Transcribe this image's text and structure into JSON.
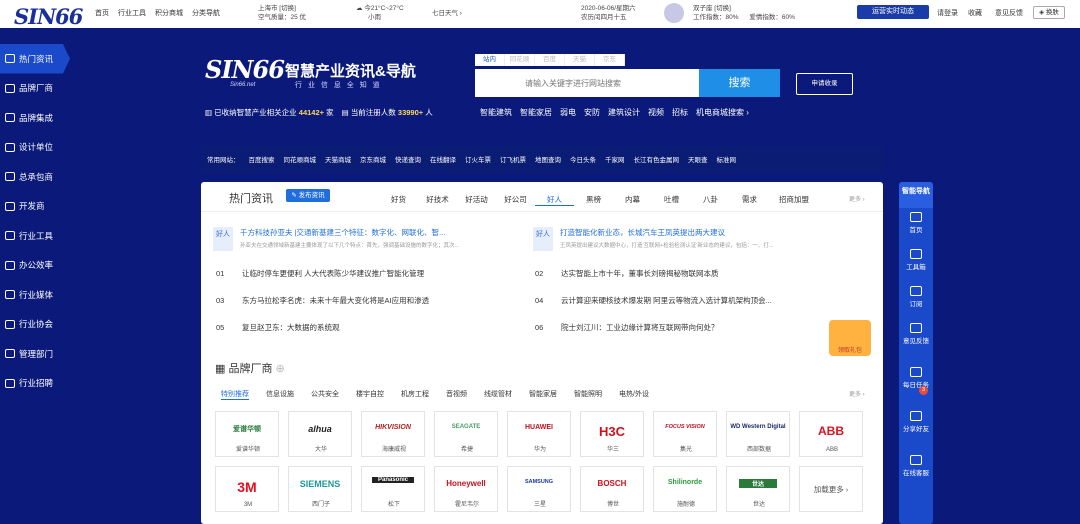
{
  "top": {
    "logo": "SIN66",
    "nav": [
      "首页",
      "行业工具",
      "积分商城",
      "分类导航"
    ],
    "city": "上海市 [切换]",
    "air": "空气质量：25 优",
    "temp": "今21°C~27°C",
    "weather": "小雨",
    "seven": "七日天气 ›",
    "date": "2020-06-06/星期六",
    "lunar": "农历闰四月十五",
    "user": "双子座 [切换]",
    "work": "工作指数：80%",
    "love": "爱情指数：60%",
    "game_btn": "运营实时动态",
    "login": "请登录",
    "fav": "收藏",
    "feedback": "意见反馈",
    "switch": "换肤"
  },
  "sidebar": [
    "热门资讯",
    "品牌厂商",
    "品牌集成",
    "设计单位",
    "总承包商",
    "开发商",
    "行业工具",
    "办公效率",
    "行业媒体",
    "行业协会",
    "管理部门",
    "行业招聘"
  ],
  "hero": {
    "brand": "SIN66",
    "brand_sub": "智慧产业资讯&导航",
    "brand_tag": "行 业 信 息 全 知 道",
    "brand_url": "Sin66.net",
    "search_tabs": [
      "站内",
      "同花顺",
      "百度",
      "天猫",
      "京东"
    ],
    "search_placeholder": "请输入关键字进行网站搜索",
    "search_btn": "搜索",
    "apply": "申请收录",
    "stat1_pre": "已收纳智慧产业相关企业",
    "stat1_num": "44142+",
    "stat1_unit": "家",
    "stat2_pre": "当前注册人数",
    "stat2_num": "33990+",
    "stat2_unit": "人",
    "hotlinks": [
      "智能建筑",
      "智能家居",
      "弱电",
      "安防",
      "建筑设计",
      "视频",
      "招标",
      "机电商城搜索 ›"
    ],
    "common": [
      "常用网站：",
      "百度搜索",
      "同花顺商城",
      "天猫商城",
      "京东商城",
      "快递查询",
      "在线翻译",
      "订火车票",
      "订飞机票",
      "地图查询",
      "今日头条",
      "千家网",
      "长江有色金属网",
      "天眼查",
      "标准网"
    ]
  },
  "news": {
    "title": "热门资讯",
    "pub": "发布资讯",
    "tabs": [
      "好货",
      "好技术",
      "好活动",
      "好公司",
      "好人",
      "黑榜",
      "内幕",
      "吐槽",
      "八卦",
      "需求",
      "招商加盟"
    ],
    "more": "更多 ›",
    "feat": [
      {
        "badge": "好人",
        "title": "千方科技孙亚夫 |交通新基建三个特征：数字化、网联化、智...",
        "desc": "孙亚夫在交通领域新基建主要体现了以下几个特点：首先，强调基础设施的数字化；其次..."
      },
      {
        "badge": "好人",
        "title": "打造智能化新业态，长城汽车王凤英提出两大建议",
        "desc": "王凤英提出建议大数据中心，打造'互联网+检验检测认证'新业态的建议，包括：一、打..."
      }
    ],
    "left": [
      {
        "no": "01",
        "t": "让临时停车更便利 人大代表陈少华建议推广智能化管理"
      },
      {
        "no": "03",
        "t": "东方马拉松李名虎：未来十年最大变化将是AI应用和渗透"
      },
      {
        "no": "05",
        "t": "复旦赵卫东：大数据的系统观"
      }
    ],
    "right": [
      {
        "no": "02",
        "t": "达实智能上市十年，董事长刘磅揭秘物联网本质"
      },
      {
        "no": "04",
        "t": "云计算迎来硬核技术爆发期 阿里云等物流入选计算机架构顶会..."
      },
      {
        "no": "06",
        "t": "院士刘江川：工业边缘计算将互联网带向何处？"
      }
    ]
  },
  "brands": {
    "title": "品牌厂商",
    "tabs": [
      "特别推荐",
      "信息设施",
      "公共安全",
      "楼宇自控",
      "机房工程",
      "音视频",
      "线缆管材",
      "智能家居",
      "智能照明",
      "电热/外设"
    ],
    "row1": [
      {
        "logo": "爱谱华顿",
        "name": "爱谱华顿"
      },
      {
        "logo": "alhua",
        "name": "大华"
      },
      {
        "logo": "HIKVISION",
        "name": "海康威视"
      },
      {
        "logo": "SEAGATE",
        "name": "希捷"
      },
      {
        "logo": "HUAWEI",
        "name": "华为"
      },
      {
        "logo": "H3C",
        "name": "华三"
      },
      {
        "logo": "FOCUS VISION",
        "name": "集光"
      },
      {
        "logo": "WD Western Digital",
        "name": "西部数据"
      },
      {
        "logo": "ABB",
        "name": "ABB"
      }
    ],
    "row2": [
      {
        "logo": "3M",
        "name": "3M"
      },
      {
        "logo": "SIEMENS",
        "name": "西门子"
      },
      {
        "logo": "Panasonic",
        "name": "松下"
      },
      {
        "logo": "Honeywell",
        "name": "霍尼韦尔"
      },
      {
        "logo": "SAMSUNG",
        "name": "三星"
      },
      {
        "logo": "BOSCH",
        "name": "博世"
      },
      {
        "logo": "Shilinorde",
        "name": "施耐德"
      },
      {
        "logo": "世达",
        "name": "世达"
      },
      {
        "logo": "加载更多 ›",
        "name": ""
      }
    ],
    "more": "更多 ›"
  },
  "gift": "领取礼包",
  "rbar": {
    "head": "智能导航",
    "items": [
      "首页",
      "工具箱",
      "订阅",
      "意见反馈",
      "每日任务",
      "分享好友",
      "在线客服"
    ],
    "badge": "3"
  }
}
